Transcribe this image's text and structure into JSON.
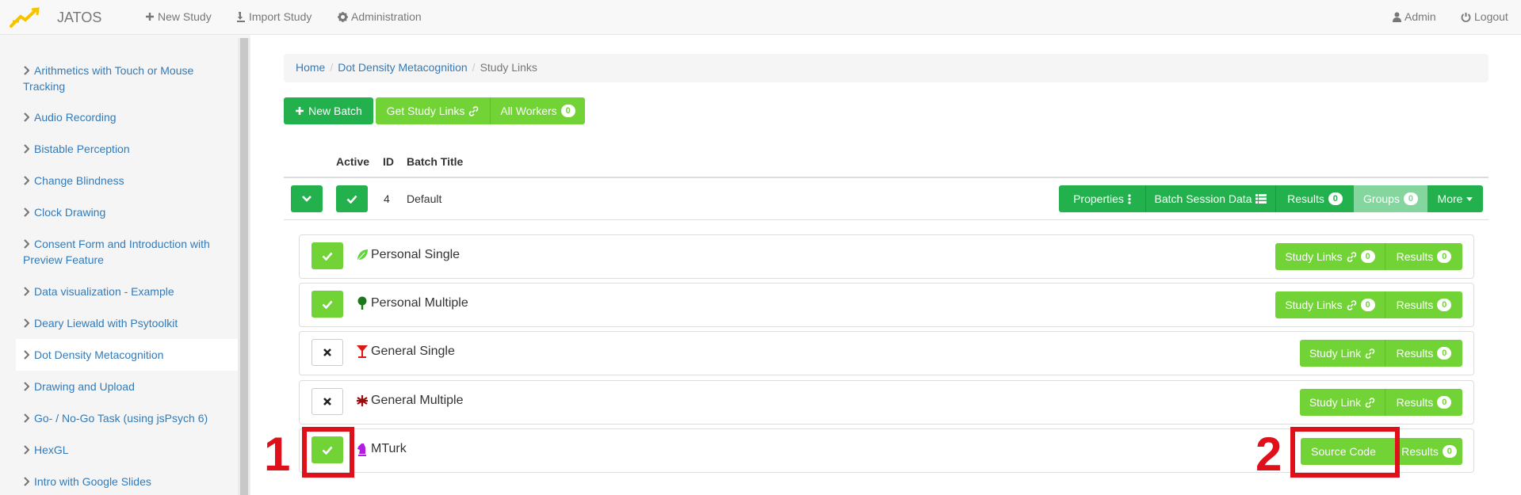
{
  "navbar": {
    "brand": "JATOS",
    "new_study": "New Study",
    "import_study": "Import Study",
    "administration": "Administration",
    "user": "Admin",
    "logout": "Logout"
  },
  "sidebar": {
    "items": [
      {
        "label_line1": "Arithmetics with Touch or Mouse",
        "label_line2": "Tracking"
      },
      {
        "label_line1": "Audio Recording"
      },
      {
        "label_line1": "Bistable Perception"
      },
      {
        "label_line1": "Change Blindness"
      },
      {
        "label_line1": "Clock Drawing"
      },
      {
        "label_line1": "Consent Form and Introduction with",
        "label_line2": "Preview Feature"
      },
      {
        "label_line1": "Data visualization - Example"
      },
      {
        "label_line1": "Deary Liewald with Psytoolkit"
      },
      {
        "label_line1": "Dot Density Metacognition",
        "active": true
      },
      {
        "label_line1": "Drawing and Upload"
      },
      {
        "label_line1": "Go- / No-Go Task (using jsPsych 6)"
      },
      {
        "label_line1": "HexGL"
      },
      {
        "label_line1": "Intro with Google Slides"
      }
    ]
  },
  "breadcrumb": {
    "home": "Home",
    "study": "Dot Density Metacognition",
    "current": "Study Links"
  },
  "toolbar": {
    "new_batch": "New Batch",
    "get_study_links": "Get Study Links",
    "all_workers": "All Workers",
    "all_workers_count": "0"
  },
  "table": {
    "headers": {
      "active": "Active",
      "id": "ID",
      "batch_title": "Batch Title"
    },
    "batch": {
      "id": "4",
      "title": "Default",
      "properties": "Properties",
      "batch_session_data": "Batch Session Data",
      "results": "Results",
      "results_count": "0",
      "groups": "Groups",
      "groups_count": "0",
      "more": "More"
    }
  },
  "study_link_types": [
    {
      "name": "Personal Single",
      "active": true,
      "links_label": "Study Links",
      "links_count": "0",
      "results_label": "Results",
      "results_count": "0",
      "icon": "leaf-icon"
    },
    {
      "name": "Personal Multiple",
      "active": true,
      "links_label": "Study Links",
      "links_count": "0",
      "results_label": "Results",
      "results_count": "0",
      "icon": "tree-icon"
    },
    {
      "name": "General Single",
      "active": false,
      "links_label": "Study Link",
      "results_label": "Results",
      "results_count": "0",
      "icon": "cocktail-glass-icon"
    },
    {
      "name": "General Multiple",
      "active": false,
      "links_label": "Study Link",
      "results_label": "Results",
      "results_count": "0",
      "icon": "asterisk-icon"
    },
    {
      "name": "MTurk",
      "active": true,
      "links_label": "Source Code",
      "results_label": "Results",
      "results_count": "0",
      "icon": "chess-knight-icon"
    }
  ],
  "annotations": {
    "one": "1",
    "two": "2"
  },
  "colors": {
    "green": "#22b14c",
    "lime": "#71d335",
    "link": "#337ab7",
    "annotation_red": "#e0101a"
  }
}
